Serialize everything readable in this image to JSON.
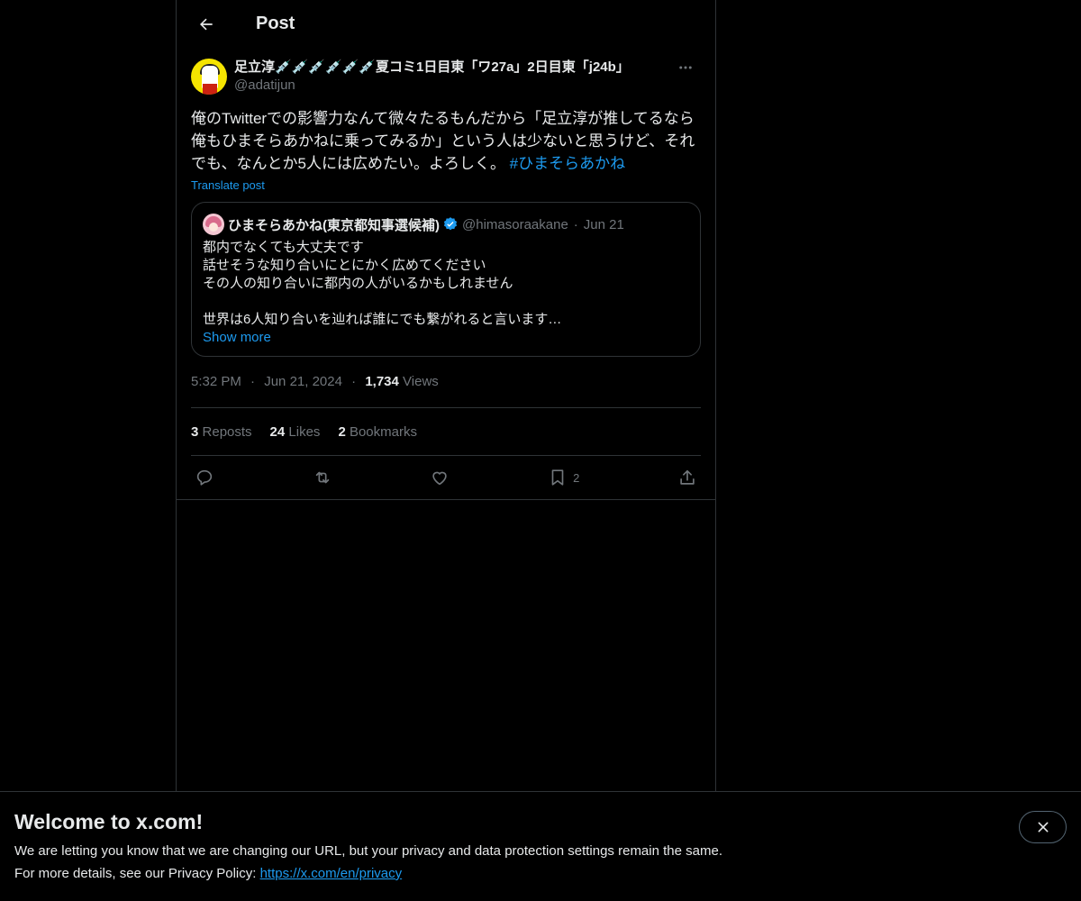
{
  "header": {
    "title": "Post"
  },
  "post": {
    "display_name": "足立淳💉💉💉💉💉💉夏コミ1日目東「ワ27a」2日目東「j24b」",
    "handle": "@adatijun",
    "text": "俺のTwitterでの影響力なんて微々たるもんだから「足立淳が推してるなら俺もひまそらあかねに乗ってみるか」という人は少ないと思うけど、それでも、なんとか5人には広めたい。よろしく。 ",
    "hashtag": "#ひまそらあかね",
    "translate": "Translate post",
    "time": "5:32 PM",
    "date": "Jun 21, 2024",
    "views_count": "1,734",
    "views_label": "Views"
  },
  "quote": {
    "name": "ひまそらあかね(東京都知事選候補)",
    "handle": "@himasoraakane",
    "date": "Jun 21",
    "lines": [
      "都内でなくても大丈夫です",
      "話せそうな知り合いにとにかく広めてください",
      "その人の知り合いに都内の人がいるかもしれません",
      "",
      "世界は6人知り合いを辿れば誰にでも繋がれると言います…"
    ],
    "show_more": "Show more"
  },
  "stats": {
    "reposts_count": "3",
    "reposts_label": "Reposts",
    "likes_count": "24",
    "likes_label": "Likes",
    "bookmarks_count": "2",
    "bookmarks_label": "Bookmarks"
  },
  "actions": {
    "bookmark_count": "2",
    "icons": [
      "reply-icon",
      "repost-icon",
      "like-icon",
      "bookmark-icon",
      "share-icon"
    ]
  },
  "banner": {
    "title": "Welcome to x.com!",
    "line1": "We are letting you know that we are changing our URL, but your privacy and data protection settings remain the same.",
    "line2_prefix": "For more details, see our Privacy Policy: ",
    "link": "https://x.com/en/privacy"
  },
  "colors": {
    "accent": "#1d9bf0",
    "text": "#e7e9ea",
    "muted": "#71767b",
    "border": "#2f3336",
    "background": "#000000"
  }
}
